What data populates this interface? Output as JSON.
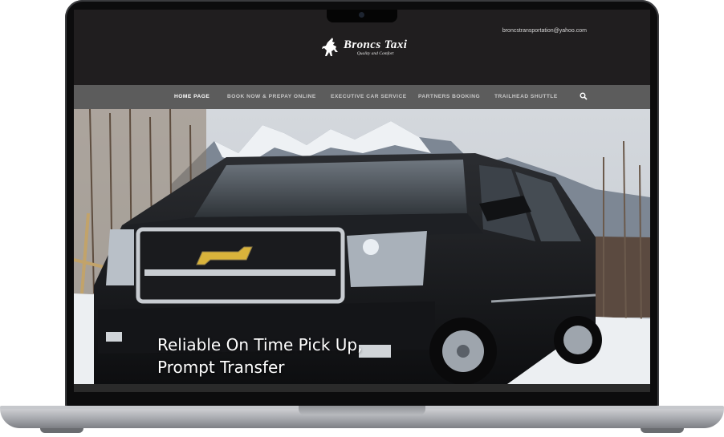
{
  "header": {
    "email": "broncstransportation@yahoo.com",
    "logo_title": "Broncs Taxi",
    "logo_subtitle": "Quality and Comfort"
  },
  "nav": {
    "items": [
      {
        "label": "HOME PAGE",
        "active": true
      },
      {
        "label": "BOOK NOW & PREPAY ONLINE",
        "active": false
      },
      {
        "label": "EXECUTIVE CAR SERVICE",
        "active": false
      },
      {
        "label": "PARTNERS BOOKING",
        "active": false
      },
      {
        "label": "TRAILHEAD SHUTTLE",
        "active": false
      }
    ],
    "search_icon": "search-icon"
  },
  "hero": {
    "line1": "Reliable On Time Pick Up,",
    "line2": "Prompt Transfer",
    "image": "black SUV in front of snowy mountains"
  },
  "colors": {
    "header_bg": "#201e1f",
    "nav_bg": "#5c5c5c",
    "nav_text": "#c9c9c9",
    "nav_active": "#ffffff"
  }
}
